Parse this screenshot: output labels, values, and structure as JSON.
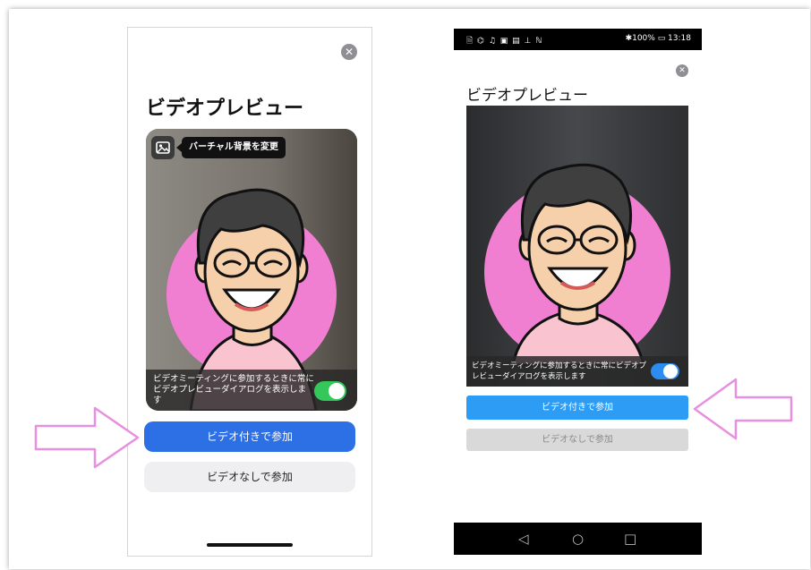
{
  "ios": {
    "title": "ビデオプレビュー",
    "close_icon": "✕",
    "virtual_bg_tooltip": "バーチャル背景を変更",
    "toggle_text": "ビデオミーティングに参加するときに常にビデオプレビューダイアログを表示します",
    "toggle_on": true,
    "join_with_video": "ビデオ付きで参加",
    "join_without_video": "ビデオなしで参加",
    "accent_color": "#2d6fe5",
    "toggle_color": "#34c759"
  },
  "android": {
    "status_icons": "🗎 ⌬ ♫ ▣ ▤ ⊥ ℕ",
    "status_right": "✱100% ▭ 13:18",
    "close_icon": "✕",
    "title": "ビデオプレビュー",
    "toggle_text": "ビデオミーティングに参加するときに常にビデオプレビューダイアログを表示します",
    "toggle_on": true,
    "join_with_video": "ビデオ付きで参加",
    "join_without_video": "ビデオなしで参加",
    "nav_back": "◁",
    "nav_home": "○",
    "nav_recent": "□",
    "accent_color": "#2d9cf5"
  },
  "annotations": {
    "arrow_color": "#e88fe0"
  }
}
